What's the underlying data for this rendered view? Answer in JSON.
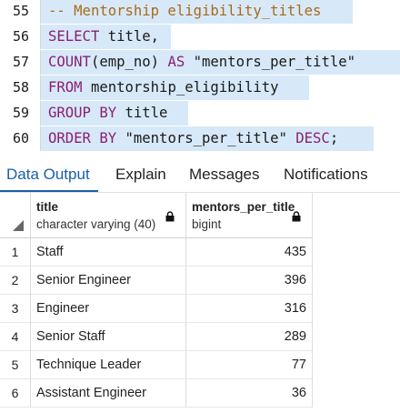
{
  "editor": {
    "lines": [
      {
        "num": "55",
        "segments": [
          {
            "t": "-- Mentorship eligibility_titles",
            "c": "cm"
          }
        ]
      },
      {
        "num": "56",
        "segments": [
          {
            "t": "SELECT",
            "c": "kw"
          },
          {
            "t": " title,",
            "c": "st"
          }
        ]
      },
      {
        "num": "57",
        "segments": [
          {
            "t": "COUNT",
            "c": "fn"
          },
          {
            "t": "(emp_no) ",
            "c": "st"
          },
          {
            "t": "AS",
            "c": "kw"
          },
          {
            "t": " \"mentors_per_title\"",
            "c": "st"
          }
        ]
      },
      {
        "num": "58",
        "segments": [
          {
            "t": "FROM",
            "c": "kw"
          },
          {
            "t": " mentorship_eligibility",
            "c": "st"
          }
        ]
      },
      {
        "num": "59",
        "segments": [
          {
            "t": "GROUP BY",
            "c": "kw"
          },
          {
            "t": " title",
            "c": "st"
          }
        ]
      },
      {
        "num": "60",
        "segments": [
          {
            "t": "ORDER BY",
            "c": "kw"
          },
          {
            "t": " \"mentors_per_title\" ",
            "c": "st"
          },
          {
            "t": "DESC",
            "c": "kw"
          },
          {
            "t": ";",
            "c": "st"
          }
        ]
      }
    ]
  },
  "tabs": {
    "data_output": "Data Output",
    "explain": "Explain",
    "messages": "Messages",
    "notifications": "Notifications"
  },
  "grid": {
    "columns": [
      {
        "name": "title",
        "type": "character varying (40)"
      },
      {
        "name": "mentors_per_title",
        "type": "bigint"
      }
    ],
    "rows": [
      {
        "num": "1",
        "title": "Staff",
        "mentors_per_title": "435"
      },
      {
        "num": "2",
        "title": "Senior Engineer",
        "mentors_per_title": "396"
      },
      {
        "num": "3",
        "title": "Engineer",
        "mentors_per_title": "316"
      },
      {
        "num": "4",
        "title": "Senior Staff",
        "mentors_per_title": "289"
      },
      {
        "num": "5",
        "title": "Technique Leader",
        "mentors_per_title": "77"
      },
      {
        "num": "6",
        "title": "Assistant Engineer",
        "mentors_per_title": "36"
      }
    ]
  },
  "colors": {
    "selection": "#d7e9f8",
    "keyword": "#8a1f73",
    "comment": "#a86a1a",
    "active_tab": "#1a5fa8"
  }
}
